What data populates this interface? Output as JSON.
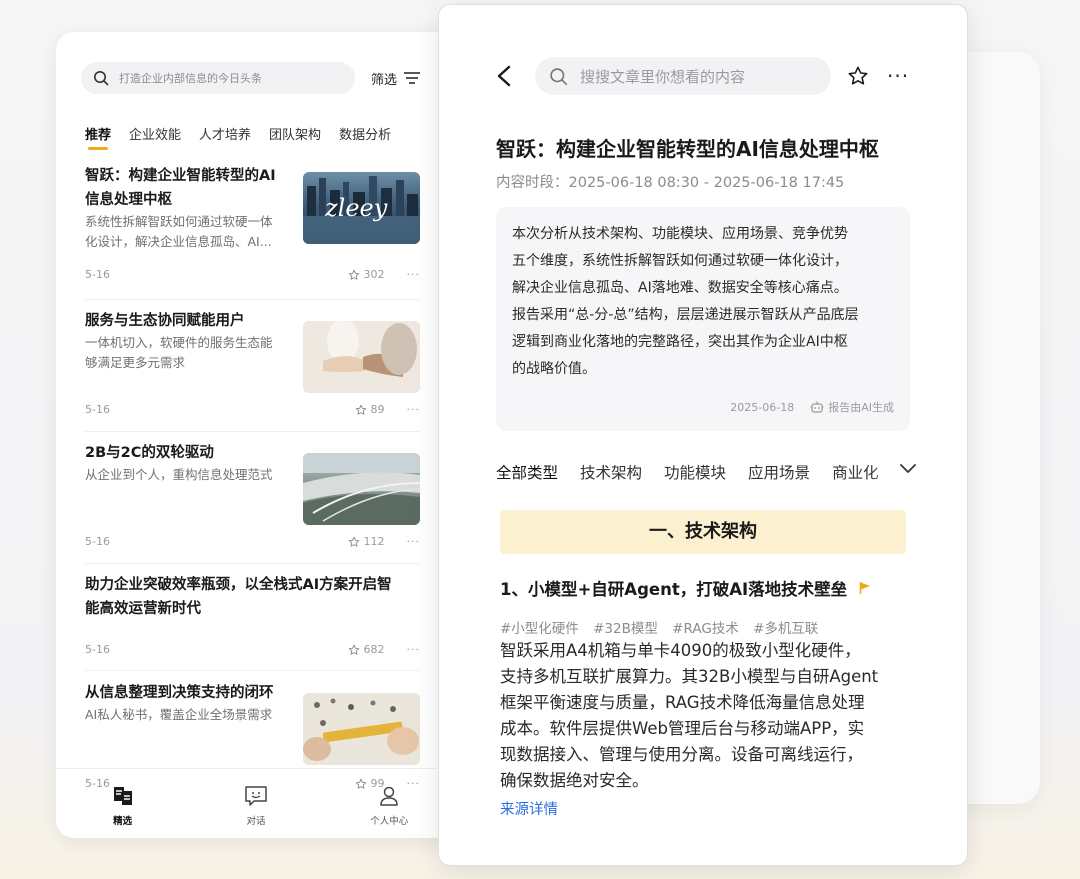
{
  "left": {
    "search_placeholder": "打造企业内部信息的今日头条",
    "filter_label": "筛选",
    "tabs": [
      "推荐",
      "企业效能",
      "人才培养",
      "团队架构",
      "数据分析"
    ],
    "feed": [
      {
        "title_line1": "智跃：构建企业智能转型的AI",
        "title_line2": "信息处理中枢",
        "desc_line1": "系统性拆解智跃如何通过软硬一体",
        "desc_line2": "化设计，解决企业信息孤岛、AI...",
        "date": "5-16",
        "stars": "302"
      },
      {
        "title_line1": "服务与生态协同赋能用户",
        "desc_line1": "一体机切入，软硬件的服务生态能",
        "desc_line2": "够满足更多元需求",
        "date": "5-16",
        "stars": "89"
      },
      {
        "title_line1": "2B与2C的双轮驱动",
        "desc_line1": "从企业到个人，重构信息处理范式",
        "date": "5-16",
        "stars": "112"
      },
      {
        "title_line1": "助力企业突破效率瓶颈，以全栈式AI方案开启智",
        "title_line2": "能高效运营新时代",
        "date": "5-16",
        "stars": "682"
      },
      {
        "title_line1": "从信息整理到决策支持的闭环",
        "desc_line1": "AI私人秘书，覆盖企业全场景需求",
        "date": "5-16",
        "stars": "99"
      }
    ],
    "bottom_tabs": [
      "精选",
      "对话",
      "个人中心"
    ],
    "thumb_text": "zleey"
  },
  "right": {
    "search_placeholder": "搜搜文章里你想看的内容",
    "title": "智跃：构建企业智能转型的AI信息处理中枢",
    "period": "内容时段：2025-06-18 08:30 - 2025-06-18 17:45",
    "summary_lines": [
      "本次分析从技术架构、功能模块、应用场景、竞争优势",
      "五个维度，系统性拆解智跃如何通过软硬一体化设计，",
      "解决企业信息孤岛、AI落地难、数据安全等核心痛点。",
      "报告采用“总-分-总”结构，层层递进展示智跃从产品底层",
      "逻辑到商业化落地的完整路径，突出其作为企业AI中枢",
      "的战略价值。"
    ],
    "summary_date": "2025-06-18",
    "summary_ai_label": "报告由AI生成",
    "tabs": [
      "全部类型",
      "技术架构",
      "功能模块",
      "应用场景",
      "商业化"
    ],
    "section_title": "一、技术架构",
    "item_heading": "1、小模型+自研Agent，打破AI落地技术壁垒",
    "tags": [
      "#小型化硬件",
      "#32B模型",
      "#RAG技术",
      "#多机互联"
    ],
    "body_lines": [
      "智跃采用A4机箱与单卡4090的极致小型化硬件，",
      "支持多机互联扩展算力。其32B小模型与自研Agent",
      "框架平衡速度与质量，RAG技术降低海量信息处理",
      "成本。软件层提供Web管理后台与移动端APP，实",
      "现数据接入、管理与使用分离。设备可离线运行，",
      "确保数据绝对安全。"
    ],
    "source_link": "来源详情"
  },
  "colors": {
    "accent": "#f2a91a",
    "link": "#2c6fe0",
    "banner": "#fbf0cf"
  }
}
